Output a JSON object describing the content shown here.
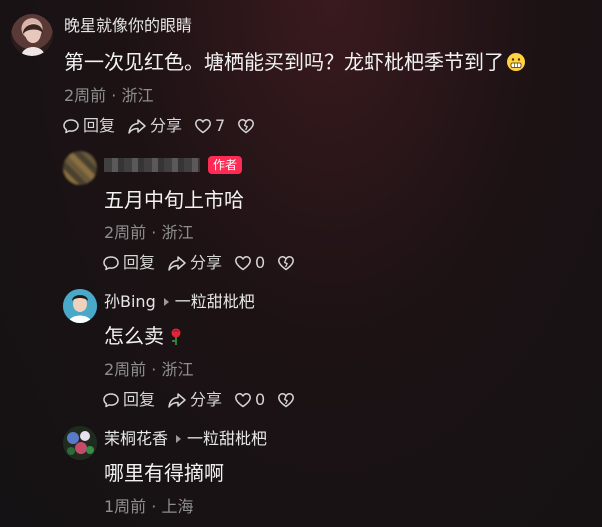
{
  "comments": [
    {
      "username": "晚星就像你的眼睛",
      "text": "第一次见红色。塘栖能买到吗？龙虾枇杷季节到了",
      "time_location": "2周前 · 浙江",
      "reply_label": "回复",
      "share_label": "分享",
      "like_count": "7"
    },
    {
      "author_badge": "作者",
      "text": "五月中旬上市哈",
      "time_location": "2周前 · 浙江",
      "reply_label": "回复",
      "share_label": "分享",
      "like_count": "0"
    },
    {
      "username": "孙Bing",
      "reply_to": "一粒甜枇杷",
      "text": "怎么卖",
      "time_location": "2周前 · 浙江",
      "reply_label": "回复",
      "share_label": "分享",
      "like_count": "0"
    },
    {
      "username": "茉桐花香",
      "reply_to": "一粒甜枇杷",
      "text": "哪里有得摘啊",
      "time_location": "1周前 · 上海"
    }
  ],
  "colors": {
    "background": "#141214",
    "author_badge": "#ff2b55",
    "meta_text": "#8e8e8e"
  },
  "icons": [
    "reply-bubble-icon",
    "share-arrow-icon",
    "heart-icon",
    "dislike-heart-icon",
    "grimace-emoji-icon",
    "rose-emoji-icon"
  ]
}
